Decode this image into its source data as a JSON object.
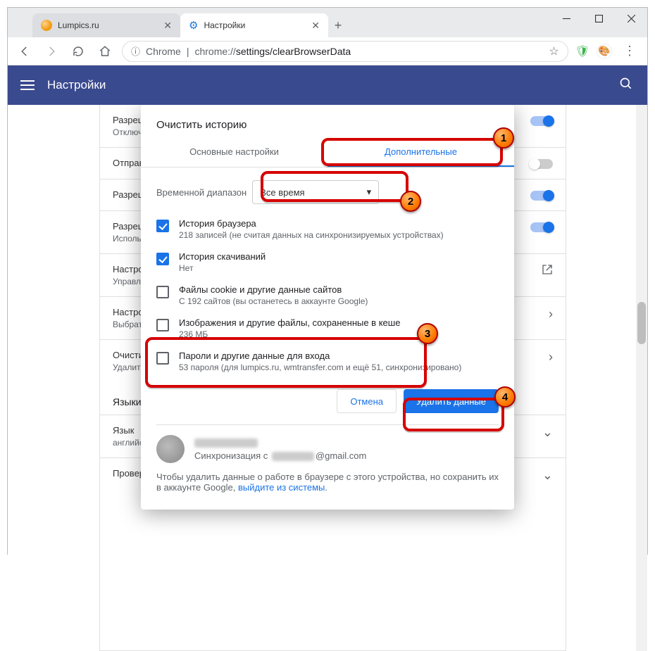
{
  "window": {
    "minimize_icon": "minimize-icon",
    "maximize_icon": "maximize-icon",
    "close_icon": "close-icon"
  },
  "tabs": [
    {
      "title": "Lumpics.ru",
      "favicon": "orange"
    },
    {
      "title": "Настройки",
      "favicon": "gear"
    }
  ],
  "new_tab_label": "+",
  "address": {
    "security_label": "Chrome",
    "url_prefix": "chrome://",
    "url_path": "settings/clearBrowserData"
  },
  "header": {
    "title": "Настройки"
  },
  "bg_settings": [
    {
      "title": "Разрешить...",
      "sub": "Отключите этот параметр, если соединение ограничено. Возможно, необходим...",
      "control": "toggle-on"
    },
    {
      "title": "Отправлять...",
      "sub": "",
      "control": "toggle-off"
    },
    {
      "title": "Разрешить...",
      "sub": "",
      "control": "toggle-on"
    },
    {
      "title": "Разрешить...",
      "sub": "Использовать веб-службу для решения проблем, связанных с навигацией (н... открывает...",
      "control": "toggle-on"
    },
    {
      "title": "Настроить...",
      "sub": "Управление сертификатами и настройками HTTPS/SSL",
      "control": "open-ext"
    },
    {
      "title": "Настройки...",
      "sub": "Выбрать, какие данные использовать для персонализации",
      "control": "chev"
    },
    {
      "title": "Очистить...",
      "sub": "Удалить файлы cookie и другие данные сайтов",
      "control": "chev"
    }
  ],
  "section_languages": "Языки",
  "lang_row_title": "Язык",
  "lang_row_sub": "английский",
  "spellcheck_row": "Проверка правописания",
  "modal": {
    "title": "Очистить историю",
    "tab_basic": "Основные настройки",
    "tab_advanced": "Дополнительные",
    "range_label": "Временной диапазон",
    "range_value": "Все время",
    "items": [
      {
        "title": "История браузера",
        "sub": "218 записей (не считая данных на синхронизируемых устройствах)",
        "checked": true
      },
      {
        "title": "История скачиваний",
        "sub": "Нет",
        "checked": true
      },
      {
        "title": "Файлы cookie и другие данные сайтов",
        "sub": "С 192 сайтов (вы останетесь в аккаунте Google)",
        "checked": false
      },
      {
        "title": "Изображения и другие файлы, сохраненные в кеше",
        "sub": "236 МБ",
        "checked": false
      },
      {
        "title": "Пароли и другие данные для входа",
        "sub": "53 пароля (для lumpics.ru, wmtransfer.com и ещё 51, синхронизировано)",
        "checked": false
      }
    ],
    "cancel": "Отмена",
    "confirm": "Удалить данные",
    "sync_prefix": "Синхронизация с",
    "sync_email_suffix": "@gmail.com",
    "footer_text1": "Чтобы удалить данные о работе в браузере с этого устройства, но сохранить их в аккаунте Google, ",
    "footer_link": "выйдите из системы",
    "footer_period": "."
  },
  "badges": {
    "b1": "1",
    "b2": "2",
    "b3": "3",
    "b4": "4"
  }
}
